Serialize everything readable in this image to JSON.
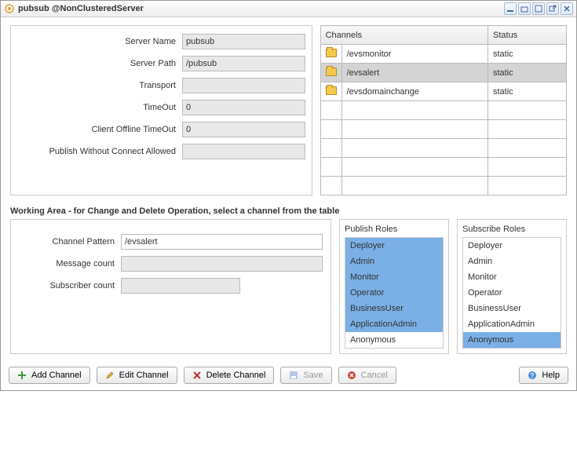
{
  "window": {
    "title": "pubsub @NonClusteredServer"
  },
  "form": {
    "server_name_label": "Server Name",
    "server_name": "pubsub",
    "server_path_label": "Server Path",
    "server_path": "/pubsub",
    "transport_label": "Transport",
    "transport": "",
    "timeout_label": "TimeOut",
    "timeout": "0",
    "client_timeout_label": "Client Offline TimeOut",
    "client_timeout": "0",
    "publish_allowed_label": "Publish Without Connect Allowed",
    "publish_allowed": ""
  },
  "channels_table": {
    "headers": {
      "channels": "Channels",
      "status": "Status"
    },
    "rows": [
      {
        "name": "/evsmonitor",
        "status": "static",
        "selected": false
      },
      {
        "name": "/evsalert",
        "status": "static",
        "selected": true
      },
      {
        "name": "/evsdomainchange",
        "status": "static",
        "selected": false
      }
    ]
  },
  "working": {
    "heading": "Working Area - for Change and Delete Operation, select a channel from the table",
    "channel_pattern_label": "Channel Pattern",
    "channel_pattern": "/evsalert",
    "message_count_label": "Message count",
    "message_count": "",
    "subscriber_count_label": "Subscriber count",
    "subscriber_count": ""
  },
  "publish_roles": {
    "title": "Publish Roles",
    "items": [
      {
        "name": "Deployer",
        "selected": true
      },
      {
        "name": "Admin",
        "selected": true
      },
      {
        "name": "Monitor",
        "selected": true
      },
      {
        "name": "Operator",
        "selected": true
      },
      {
        "name": "BusinessUser",
        "selected": true
      },
      {
        "name": "ApplicationAdmin",
        "selected": true
      },
      {
        "name": "Anonymous",
        "selected": false
      }
    ]
  },
  "subscribe_roles": {
    "title": "Subscribe Roles",
    "items": [
      {
        "name": "Deployer",
        "selected": false
      },
      {
        "name": "Admin",
        "selected": false
      },
      {
        "name": "Monitor",
        "selected": false
      },
      {
        "name": "Operator",
        "selected": false
      },
      {
        "name": "BusinessUser",
        "selected": false
      },
      {
        "name": "ApplicationAdmin",
        "selected": false
      },
      {
        "name": "Anonymous",
        "selected": true
      }
    ]
  },
  "toolbar": {
    "add": "Add Channel",
    "edit": "Edit Channel",
    "delete": "Delete Channel",
    "save": "Save",
    "cancel": "Cancel",
    "help": "Help"
  }
}
